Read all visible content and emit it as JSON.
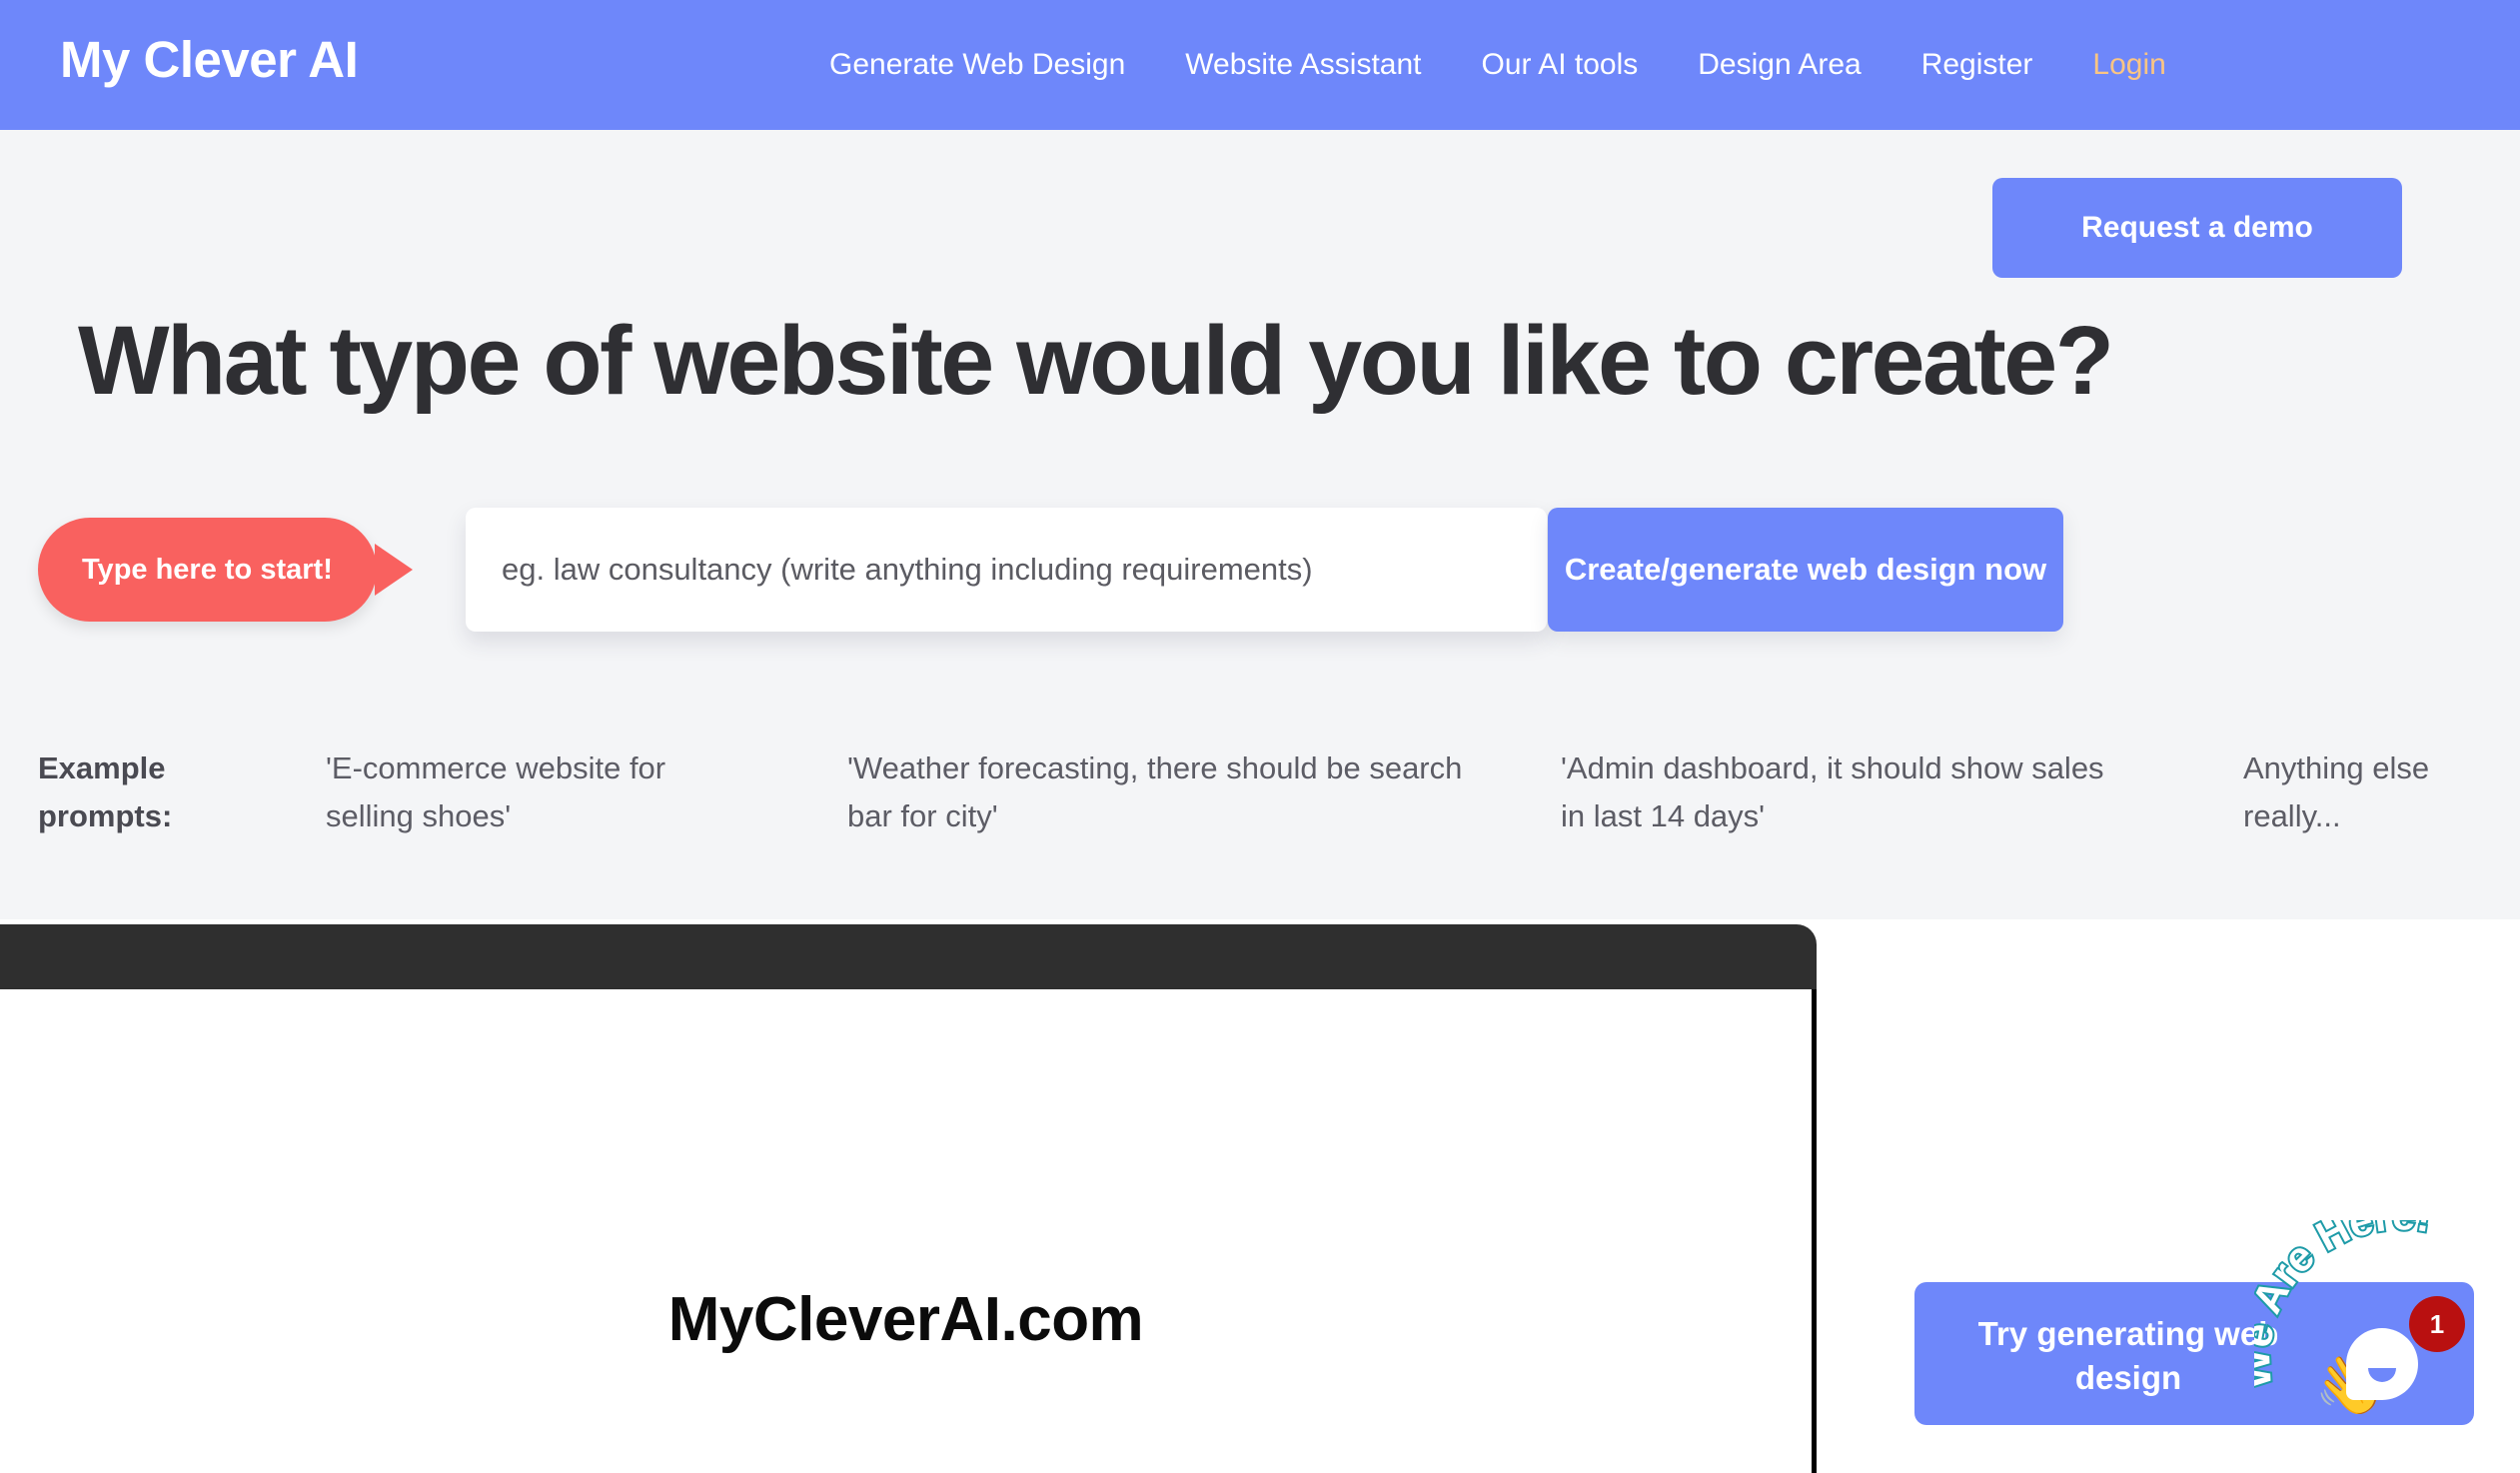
{
  "colors": {
    "brand_blue": "#6E87FA",
    "accent_orange": "#FBC583",
    "badge_red": "#F9615F",
    "notification_red": "#B91010",
    "hero_bg": "#F4F5F7",
    "heading_dark": "#2F2F33",
    "chrome_dark": "#2F2F2F",
    "we_are_here_outline": "#1E9BA8"
  },
  "nav": {
    "brand": "My Clever AI",
    "links": [
      {
        "label": "Generate Web Design",
        "accent": false
      },
      {
        "label": "Website Assistant",
        "accent": false
      },
      {
        "label": "Our AI tools",
        "accent": false
      },
      {
        "label": "Design Area",
        "accent": false
      },
      {
        "label": "Register",
        "accent": false
      },
      {
        "label": "Login",
        "accent": true
      }
    ]
  },
  "hero": {
    "demo_button": "Request a demo",
    "headline": "What type of website would you like to create?"
  },
  "prompt": {
    "badge": "Type here to start!",
    "input_value": "",
    "input_placeholder": "eg. law consultancy (write anything including requirements)",
    "submit_label": "Create/generate web design now"
  },
  "examples": {
    "label": "Example prompts:",
    "items": [
      "'E-commerce website for selling shoes'",
      "'Weather forecasting, there should be search bar for city'",
      "'Admin dashboard, it should show sales in last 14 days'",
      "Anything else really..."
    ]
  },
  "mockup": {
    "logo": "MyCleverAI.com"
  },
  "chat": {
    "message": "Try generating web design",
    "wave_icon": "wave-hand-icon",
    "wave_glyph": "👋",
    "bubble_icon": "speech-bubble-icon",
    "badge_count": "1",
    "we_are_here": "We Are Here!"
  }
}
